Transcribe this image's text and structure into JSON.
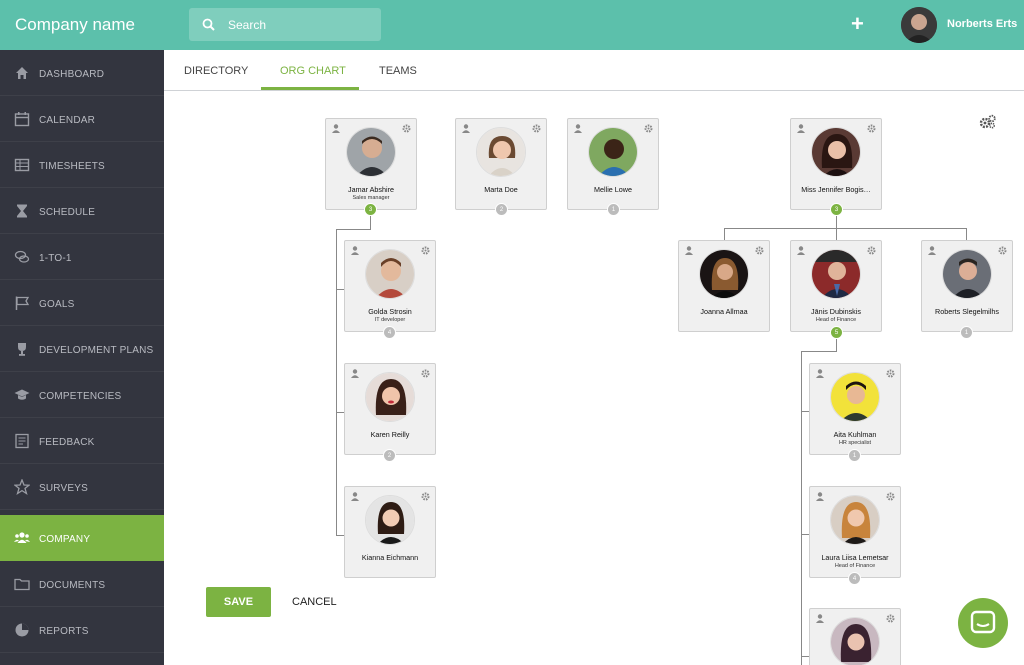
{
  "header": {
    "company_name": "Company name",
    "search_placeholder": "Search",
    "add_label": "+",
    "user_name": "Norberts Erts"
  },
  "sidebar": {
    "items": [
      {
        "label": "DASHBOARD",
        "icon": "home-icon",
        "active": false
      },
      {
        "label": "CALENDAR",
        "icon": "calendar-icon",
        "active": false
      },
      {
        "label": "TIMESHEETS",
        "icon": "timesheet-icon",
        "active": false
      },
      {
        "label": "SCHEDULE",
        "icon": "hourglass-icon",
        "active": false
      },
      {
        "label": "1-TO-1",
        "icon": "chat-bubbles-icon",
        "active": false
      },
      {
        "label": "GOALS",
        "icon": "flag-icon",
        "active": false
      },
      {
        "label": "DEVELOPMENT PLANS",
        "icon": "trophy-icon",
        "active": false
      },
      {
        "label": "COMPETENCIES",
        "icon": "graduation-cap-icon",
        "active": false
      },
      {
        "label": "FEEDBACK",
        "icon": "feedback-icon",
        "active": false
      },
      {
        "label": "SURVEYS",
        "icon": "star-icon",
        "active": false
      },
      {
        "label": "COMPANY",
        "icon": "users-icon",
        "active": true
      },
      {
        "label": "DOCUMENTS",
        "icon": "folder-icon",
        "active": false
      },
      {
        "label": "REPORTS",
        "icon": "pie-chart-icon",
        "active": false
      }
    ]
  },
  "tabs": [
    {
      "label": "DIRECTORY",
      "active": false
    },
    {
      "label": "ORG CHART",
      "active": true
    },
    {
      "label": "TEAMS",
      "active": false
    }
  ],
  "org": {
    "jamar": {
      "name": "Jamar Abshire",
      "role": "Sales manager",
      "count": "3"
    },
    "marta": {
      "name": "Marta Doe",
      "role": "",
      "count": "2"
    },
    "mellie": {
      "name": "Mellie Lowe",
      "role": "",
      "count": "1"
    },
    "jennifer": {
      "name": "Miss Jennifer Bogis…",
      "role": "",
      "count": "3"
    },
    "golda": {
      "name": "Golda Strosin",
      "role": "IT developer",
      "count": "4"
    },
    "karen": {
      "name": "Karen Reilly",
      "role": "",
      "count": "2"
    },
    "kianna": {
      "name": "Kianna Eichmann",
      "role": "",
      "count": ""
    },
    "joanna": {
      "name": "Joanna Allmaa",
      "role": "",
      "count": ""
    },
    "janis": {
      "name": "Jānis Dubinskis",
      "role": "Head of Finance",
      "count": "5"
    },
    "roberts": {
      "name": "Roberts Slegelmilhs",
      "role": "",
      "count": "1"
    },
    "aita": {
      "name": "Aita Kuhlman",
      "role": "HR specialist",
      "count": "1"
    },
    "laura": {
      "name": "Laura Liisa Lemetsar",
      "role": "Head of Finance",
      "count": "4"
    },
    "bottom": {
      "name": "",
      "role": "",
      "count": ""
    }
  },
  "actions": {
    "save_label": "SAVE",
    "cancel_label": "CANCEL"
  },
  "colors": {
    "topbar": "#5cc0ab",
    "sidebar": "#33353f",
    "accent": "#7cb342"
  }
}
